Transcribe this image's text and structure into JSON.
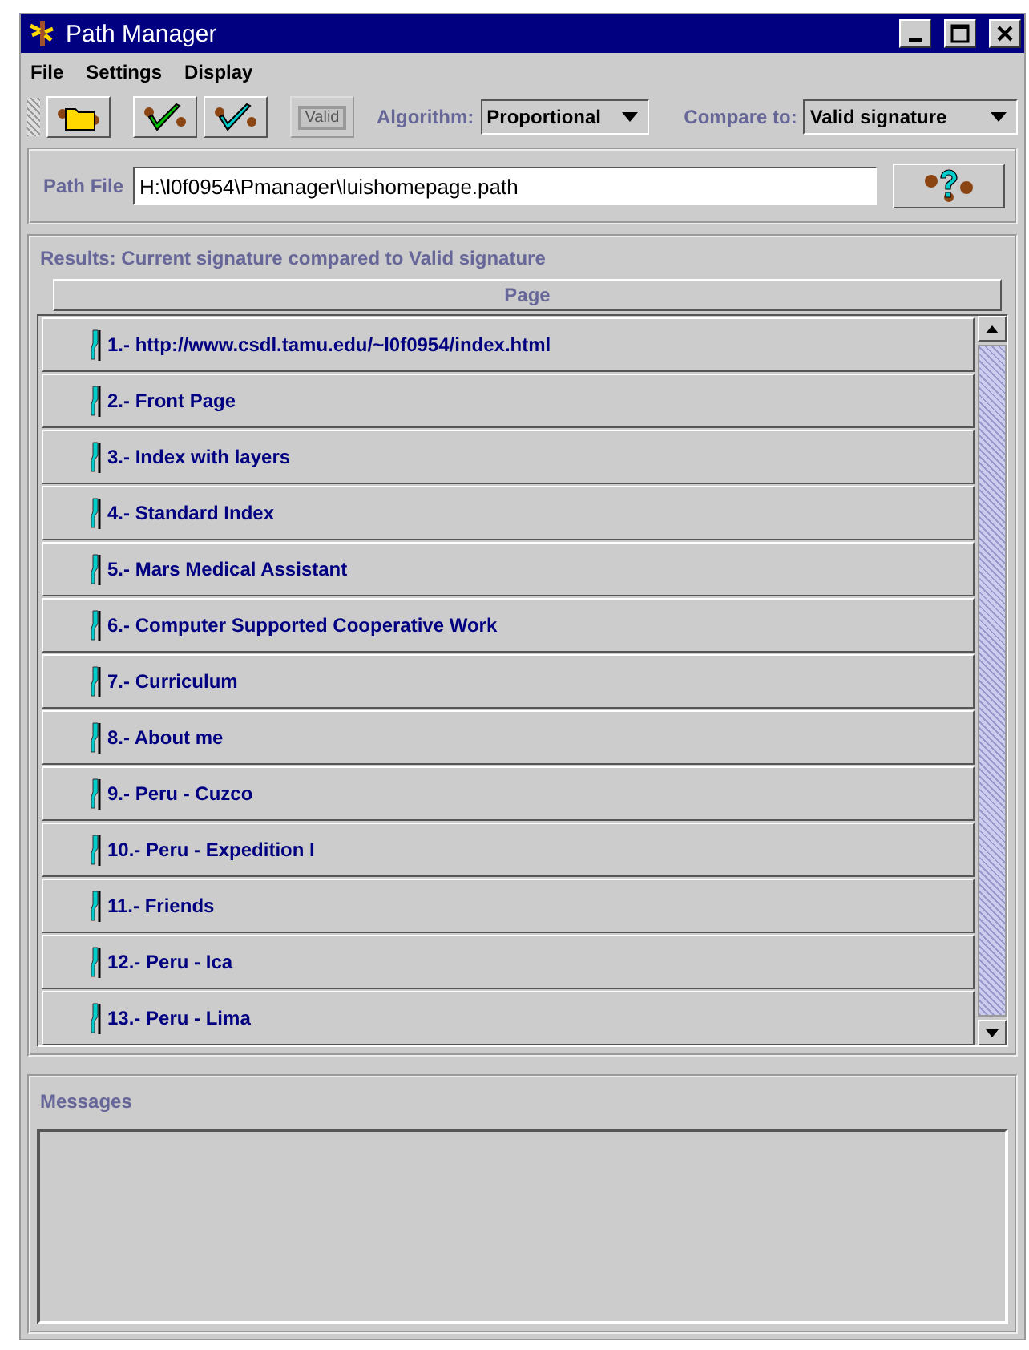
{
  "window": {
    "title": "Path Manager"
  },
  "menu": [
    "File",
    "Settings",
    "Display"
  ],
  "toolbar": {
    "buttons": [
      {
        "kind": "folder",
        "disabled": false
      },
      {
        "kind": "green-check",
        "disabled": false
      },
      {
        "kind": "cyan-check",
        "disabled": false
      },
      {
        "kind": "stamp",
        "label": "Valid",
        "disabled": true
      }
    ],
    "algorithm": {
      "label": "Algorithm:",
      "value": "Proportional"
    },
    "compare_to": {
      "label": "Compare to:",
      "value": "Valid signature"
    }
  },
  "path_file": {
    "label": "Path File",
    "value": "H:\\l0f0954\\Pmanager\\luishomepage.path"
  },
  "results": {
    "title": "Results: Current signature compared to Valid signature",
    "column": "Page",
    "rows": [
      "1.- http://www.csdl.tamu.edu/~l0f0954/index.html",
      "2.- Front Page",
      "3.- Index with layers",
      "4.- Standard Index",
      "5.- Mars Medical Assistant",
      "6.- Computer Supported Cooperative Work",
      "7.- Curriculum",
      "8.- About me",
      "9.- Peru - Cuzco",
      "10.- Peru - Expedition I",
      "11.- Friends",
      "12.- Peru - Ica",
      "13.- Peru - Lima"
    ]
  },
  "messages": {
    "title": "Messages"
  }
}
